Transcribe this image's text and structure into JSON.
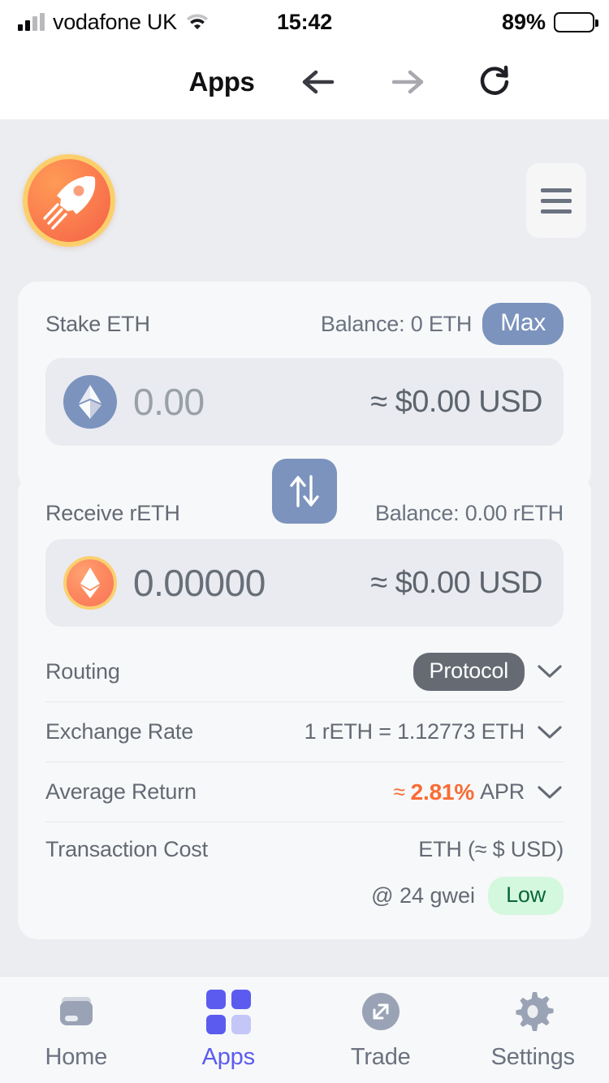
{
  "statusbar": {
    "carrier": "vodafone UK",
    "time": "15:42",
    "battery_pct": "89%",
    "signal_icon": "signal-bars-icon",
    "wifi_icon": "wifi-icon",
    "battery_icon": "battery-icon"
  },
  "chrome": {
    "title": "Apps",
    "back_icon": "arrow-left-icon",
    "forward_icon": "arrow-right-icon",
    "reload_icon": "reload-icon"
  },
  "apphead": {
    "logo_icon": "rocket-logo-icon",
    "menu_icon": "hamburger-menu-icon"
  },
  "stake": {
    "label": "Stake ETH",
    "balance": "Balance: 0 ETH",
    "max_label": "Max",
    "amount": "0.00",
    "amount_placeholder": "0.00",
    "usd": "≈ $0.00 USD",
    "coin_icon": "ethereum-coin-icon"
  },
  "swap": {
    "icon": "swap-vertical-arrows-icon"
  },
  "receive": {
    "label": "Receive rETH",
    "balance": "Balance: 0.00 rETH",
    "amount": "0.00000",
    "usd": "≈ $0.00 USD",
    "coin_icon": "reth-coin-icon"
  },
  "details": [
    {
      "label": "Routing",
      "value": "Protocol",
      "kind": "pill"
    },
    {
      "label": "Exchange Rate",
      "value": "1 rETH = 1.12773 ETH",
      "kind": "text"
    },
    {
      "label": "Average Return",
      "approx": "≈",
      "value": "2.81%",
      "unit": "APR",
      "kind": "apr"
    }
  ],
  "transaction": {
    "label": "Transaction Cost",
    "value": "ETH (≈ $ USD)",
    "gwei": "@ 24 gwei",
    "badge": "Low"
  },
  "tabbar": {
    "items": [
      {
        "label": "Home",
        "icon": "wallet-icon",
        "active": false
      },
      {
        "label": "Apps",
        "icon": "grid-icon",
        "active": true
      },
      {
        "label": "Trade",
        "icon": "expand-arrows-icon",
        "active": false
      },
      {
        "label": "Settings",
        "icon": "gear-icon",
        "active": false
      }
    ]
  },
  "colors": {
    "accent_blue": "#7b93bd",
    "active_tab": "#5b5bf0",
    "apr_orange": "#f96c34",
    "badge_low_bg": "#d4f8de",
    "badge_low_text": "#0a6638",
    "pill_gray": "#666b73",
    "page_bg": "#ebedf1",
    "card_bg": "#f7f8f9"
  }
}
